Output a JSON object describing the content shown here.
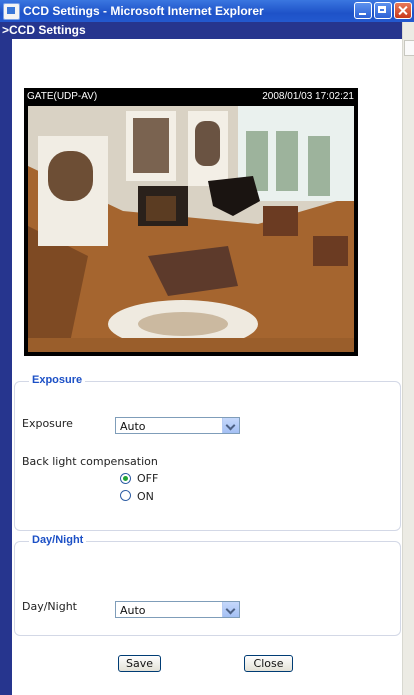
{
  "window": {
    "title": "CCD Settings - Microsoft Internet Explorer"
  },
  "page": {
    "header": ">CCD Settings"
  },
  "video": {
    "camera_name": "GATE(UDP-AV)",
    "timestamp": "2008/01/03 17:02:21"
  },
  "exposure_section": {
    "legend": "Exposure",
    "exposure_label": "Exposure",
    "exposure_value": "Auto",
    "backlight_label": "Back light compensation",
    "options": [
      {
        "label": "OFF",
        "checked": true
      },
      {
        "label": "ON",
        "checked": false
      }
    ]
  },
  "daynight_section": {
    "legend": "Day/Night",
    "daynight_label": "Day/Night",
    "daynight_value": "Auto"
  },
  "buttons": {
    "save": "Save",
    "close": "Close"
  },
  "colors": {
    "header_bar": "#26358e",
    "legend_text": "#1c50c6",
    "titlebar": "#2359cf"
  }
}
